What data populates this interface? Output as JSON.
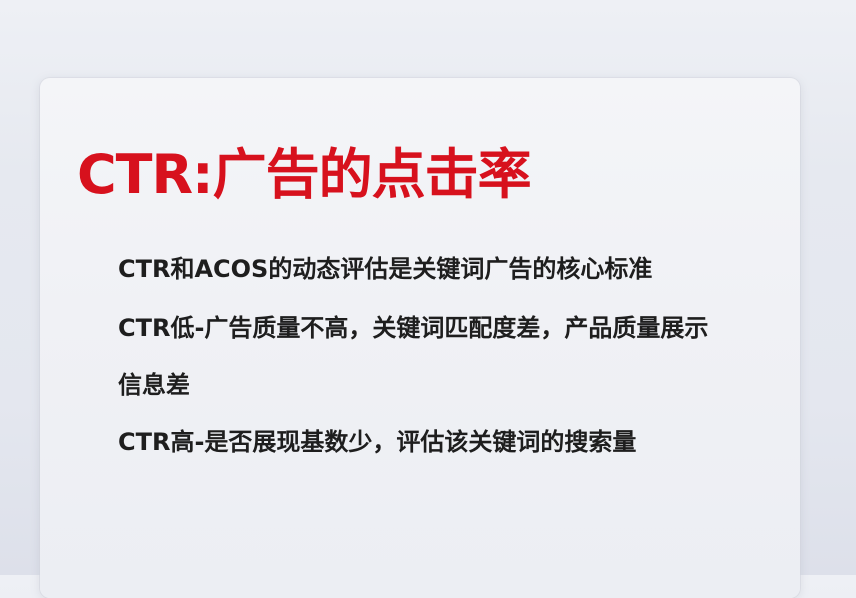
{
  "slide": {
    "title": "CTR:广告的点击率",
    "lines": [
      "CTR和ACOS的动态评估是关键词广告的核心标准",
      "CTR低-广告质量不高，关键词匹配度差，产品质量展示",
      "信息差",
      "CTR高-是否展现基数少，评估该关键词的搜索量"
    ]
  },
  "colors": {
    "title": "#d7111d",
    "text": "#1e1e1e",
    "background": "#e6e9f0",
    "card": "#f2f3f7"
  }
}
